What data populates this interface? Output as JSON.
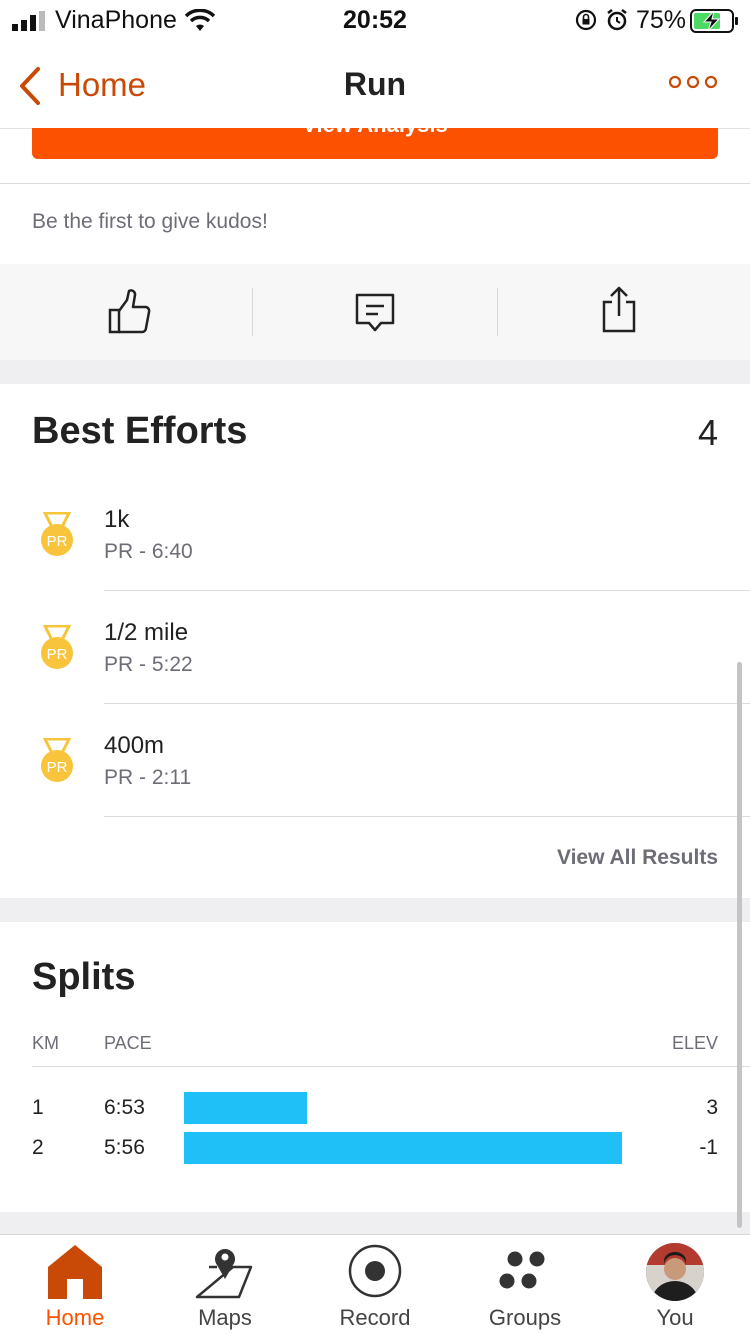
{
  "status_bar": {
    "carrier": "VinaPhone",
    "time": "20:52",
    "battery": "75%"
  },
  "nav": {
    "back_label": "Home",
    "title": "Run"
  },
  "analysis_button": {
    "label": "View Analysis"
  },
  "kudos": {
    "prompt": "Be the first to give kudos!"
  },
  "actions": {
    "icons": [
      "thumbs-up-icon",
      "comment-icon",
      "share-icon"
    ]
  },
  "best_efforts": {
    "title": "Best Efforts",
    "count": "4",
    "items": [
      {
        "name": "1k",
        "detail": "PR - 6:40",
        "badge": "PR"
      },
      {
        "name": "1/2 mile",
        "detail": "PR - 5:22",
        "badge": "PR"
      },
      {
        "name": "400m",
        "detail": "PR - 2:11",
        "badge": "PR"
      }
    ],
    "view_all": "View All Results"
  },
  "splits": {
    "title": "Splits",
    "columns": {
      "km": "KM",
      "pace": "PACE",
      "elev": "ELEV"
    },
    "rows": [
      {
        "km": "1",
        "pace": "6:53",
        "elev": "3",
        "bar_fraction": 0.28
      },
      {
        "km": "2",
        "pace": "5:56",
        "elev": "-1",
        "bar_fraction": 1.0
      }
    ],
    "bar_color": "#1fc0f7"
  },
  "tabbar": {
    "tabs": [
      {
        "label": "Home",
        "icon": "home-icon",
        "active": true
      },
      {
        "label": "Maps",
        "icon": "map-icon",
        "active": false
      },
      {
        "label": "Record",
        "icon": "record-icon",
        "active": false
      },
      {
        "label": "Groups",
        "icon": "groups-icon",
        "active": false
      },
      {
        "label": "You",
        "icon": "avatar",
        "active": false
      }
    ]
  },
  "colors": {
    "accent": "#fc5200",
    "nav_accent": "#c94a06",
    "medal": "#f7c43c"
  }
}
